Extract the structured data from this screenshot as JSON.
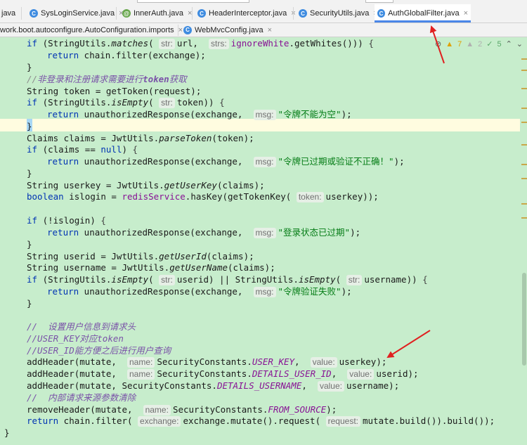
{
  "tabs_row1": [
    {
      "label": "java",
      "icon": "none"
    },
    {
      "label": "SysLoginService.java",
      "icon": "class-icon"
    },
    {
      "label": "InnerAuth.java",
      "icon": "annotation-icon"
    },
    {
      "label": "HeaderInterceptor.java",
      "icon": "class-icon"
    },
    {
      "label": "SecurityUtils.java",
      "icon": "class-icon"
    },
    {
      "label": "AuthGlobalFilter.java",
      "icon": "class-icon",
      "active": true
    }
  ],
  "tabs_row2": [
    {
      "label": "work.boot.autoconfigure.AutoConfiguration.imports",
      "icon": "spring-icon"
    },
    {
      "label": "WebMvcConfig.java",
      "icon": "class-icon"
    }
  ],
  "tab_close_glyph": "×",
  "inspections": {
    "warnings": "7",
    "weak_warnings": "2",
    "ok": "5"
  },
  "code": {
    "l1": {
      "a": "if (StringUtils.",
      "b": "matches",
      "c": "( ",
      "h1": "str:",
      "d": " url,  ",
      "h2": "strs:",
      "e": " ",
      "f": "ignoreWhite",
      "g": ".getWhites())) {"
    },
    "l2": {
      "a": "return chain.filter(exchange);"
    },
    "l3": {
      "a": "}"
    },
    "l4": {
      "a": "//",
      "b": "非登录和注册请求需要进行",
      "c": "token",
      "d": "获取"
    },
    "l5": {
      "a": "String token = getToken(request);"
    },
    "l6": {
      "a": "if (StringUtils.",
      "b": "isEmpty",
      "c": "( ",
      "h1": "str:",
      "d": " token)) {"
    },
    "l7": {
      "a": "return unauthorizedResponse(exchange,  ",
      "h1": "msg:",
      "s": "\"令牌不能为空\"",
      "e": ");"
    },
    "l8": {
      "a": "}"
    },
    "l9": {
      "a": "Claims claims = JwtUtils.",
      "b": "parseToken",
      "c": "(token);"
    },
    "l10": {
      "a": "if (claims == ",
      "k": "null",
      "b": ") {"
    },
    "l11": {
      "a": "return unauthorizedResponse(exchange,  ",
      "h1": "msg:",
      "s": "\"令牌已过期或验证不正确！\"",
      "e": ");"
    },
    "l12": {
      "a": "}"
    },
    "l13": {
      "a": "String userkey = JwtUtils.",
      "b": "getUserKey",
      "c": "(claims);"
    },
    "l14": {
      "k": "boolean",
      "a": " islogin = ",
      "f": "redisService",
      "b": ".hasKey(getTokenKey( ",
      "h1": "token:",
      "c": " userkey));"
    },
    "l15": {
      "a": "if (!islogin) {"
    },
    "l16": {
      "a": "return unauthorizedResponse(exchange,  ",
      "h1": "msg:",
      "s": "\"登录状态已过期\"",
      "e": ");"
    },
    "l17": {
      "a": "}"
    },
    "l18": {
      "a": "String userid = JwtUtils.",
      "b": "getUserId",
      "c": "(claims);"
    },
    "l19": {
      "a": "String username = JwtUtils.",
      "b": "getUserName",
      "c": "(claims);"
    },
    "l20": {
      "a": "if (StringUtils.",
      "b": "isEmpty",
      "c": "( ",
      "h1": "str:",
      "d": " userid) || StringUtils.",
      "e": "isEmpty",
      "f": "( ",
      "h2": "str:",
      "g": " username)) {"
    },
    "l21": {
      "a": "return unauthorizedResponse(exchange,  ",
      "h1": "msg:",
      "s": "\"令牌验证失败\"",
      "e": ");"
    },
    "l22": {
      "a": "}"
    },
    "l23": {
      "a": "//  设置用户信息到请求头"
    },
    "l24": {
      "a": "//USER_KEY",
      "b": "对应",
      "c": "token"
    },
    "l25": {
      "a": "//USER_ID",
      "b": "能方便之后进行用户查询"
    },
    "l26": {
      "a": "addHeader(mutate,  ",
      "h1": "name:",
      "b": " SecurityConstants.",
      "c": "USER_KEY",
      "d": ",  ",
      "h2": "value:",
      "e": " userkey);"
    },
    "l27": {
      "a": "addHeader(mutate,  ",
      "h1": "name:",
      "b": " SecurityConstants.",
      "c": "DETAILS_USER_ID",
      "d": ",  ",
      "h2": "value:",
      "e": " userid);"
    },
    "l28": {
      "a": "addHeader(mutate, SecurityConstants.",
      "c": "DETAILS_USERNAME",
      "d": ",  ",
      "h2": "value:",
      "e": " username);"
    },
    "l29": {
      "a": "//  内部请求来源参数清除"
    },
    "l30": {
      "a": "removeHeader(mutate,  ",
      "h1": "name:",
      "b": " SecurityConstants.",
      "c": "FROM_SOURCE",
      "d": ");"
    },
    "l31": {
      "a": "return chain.filter( ",
      "h1": "exchange:",
      "b": " exchange.mutate().request( ",
      "h2": "request:",
      "c": " mutate.build()).build());"
    },
    "l32": {
      "a": "}"
    }
  }
}
